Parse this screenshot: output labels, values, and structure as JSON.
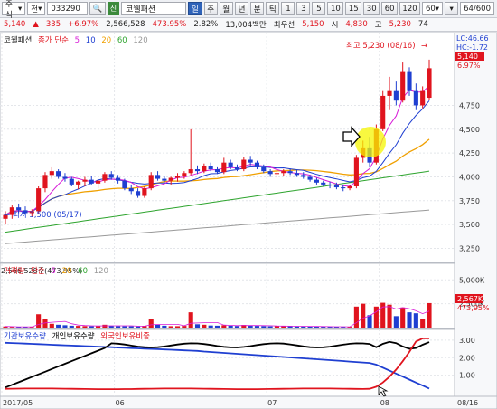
{
  "toolbar": {
    "market": "주식",
    "market_type": "전",
    "code": "033290",
    "tag": "신",
    "name": "코웰패션",
    "periods": [
      "일",
      "주",
      "월",
      "년",
      "분",
      "틱"
    ],
    "counts": [
      "1",
      "3",
      "5",
      "10",
      "15",
      "30",
      "60",
      "120"
    ],
    "extra": "60",
    "page": "64/600"
  },
  "quote": {
    "price": "5,140",
    "change": "335",
    "change_pct": "+6.97%",
    "volume": "2,566,528",
    "vol_ratio": "473.95%",
    "turnover": "2.82%",
    "amount": "13,004백만",
    "best": "최우선",
    "best_price": "5,150",
    "open_label": "시",
    "open": "4,830",
    "high_label": "고",
    "high": "5,230",
    "scroll": "74"
  },
  "price_panel": {
    "legend_title": "코웰패션",
    "legend_sub": "종가 단순",
    "ma": [
      "5",
      "10",
      "20",
      "60",
      "120"
    ],
    "max_label": "최고 5,230 (08/16)",
    "min_label": "최저 3,500 (05/17)",
    "lc": "LC:46.66",
    "hc": "HC:-1.72",
    "current": "5,140",
    "current_pct": "6.97%",
    "yticks": [
      "4,750",
      "4,500",
      "4,250",
      "4,000",
      "3,750",
      "3,500",
      "3,250"
    ]
  },
  "volume_panel": {
    "title": "거래량",
    "sub": "단순",
    "ma": [
      "5",
      "20",
      "60",
      "120"
    ],
    "value": "2,566,528주(473,95%)",
    "yticks": [
      "5,000K",
      "2,500K"
    ],
    "current": "2,567K",
    "current_pct": "473,95%"
  },
  "holding_panel": {
    "items": [
      "기관보유수량",
      "개인보유수량",
      "외국인보유비중"
    ],
    "yticks": [
      "3.00",
      "2.00",
      "1.00"
    ]
  },
  "dates": [
    "2017/05",
    "06",
    "07",
    "08",
    "08/16"
  ],
  "colors": {
    "up": "#e0141e",
    "down": "#1f3fd1",
    "ma5": "#d81bd8",
    "ma10": "#1f3fd1",
    "ma20": "#f0a000",
    "ma60": "#2ea42e",
    "ma120": "#999999"
  },
  "chart_data": {
    "type": "candlestick",
    "ohlc": [
      [
        3560,
        3640,
        3500,
        3600
      ],
      [
        3600,
        3700,
        3560,
        3680
      ],
      [
        3680,
        3720,
        3620,
        3650
      ],
      [
        3650,
        3690,
        3600,
        3620
      ],
      [
        3620,
        3660,
        3580,
        3640
      ],
      [
        3640,
        3900,
        3620,
        3880
      ],
      [
        3880,
        4050,
        3840,
        4020
      ],
      [
        4020,
        4100,
        3980,
        4060
      ],
      [
        4060,
        4080,
        3980,
        4000
      ],
      [
        4000,
        4040,
        3950,
        3980
      ],
      [
        3980,
        4000,
        3900,
        3920
      ],
      [
        3920,
        3960,
        3870,
        3950
      ],
      [
        3950,
        4000,
        3900,
        3970
      ],
      [
        3970,
        4010,
        3920,
        3930
      ],
      [
        3930,
        3970,
        3880,
        3960
      ],
      [
        3960,
        4050,
        3940,
        4030
      ],
      [
        4030,
        4060,
        3970,
        3990
      ],
      [
        3990,
        4020,
        3930,
        3960
      ],
      [
        3960,
        3980,
        3860,
        3880
      ],
      [
        3880,
        3920,
        3820,
        3850
      ],
      [
        3850,
        3880,
        3780,
        3800
      ],
      [
        3800,
        3900,
        3780,
        3880
      ],
      [
        3880,
        4050,
        3860,
        4020
      ],
      [
        4020,
        4060,
        3960,
        3980
      ],
      [
        3980,
        4010,
        3930,
        3960
      ],
      [
        3960,
        4000,
        3920,
        3990
      ],
      [
        3990,
        4040,
        3950,
        4010
      ],
      [
        4010,
        4060,
        3980,
        4040
      ],
      [
        4040,
        4500,
        4020,
        4080
      ],
      [
        4080,
        4120,
        4030,
        4060
      ],
      [
        4060,
        4140,
        4040,
        4110
      ],
      [
        4110,
        4150,
        4060,
        4080
      ],
      [
        4080,
        4100,
        4030,
        4050
      ],
      [
        4050,
        4200,
        4030,
        4150
      ],
      [
        4150,
        4180,
        4080,
        4100
      ],
      [
        4100,
        4130,
        4060,
        4080
      ],
      [
        4080,
        4210,
        4060,
        4180
      ],
      [
        4180,
        4220,
        4120,
        4150
      ],
      [
        4150,
        4170,
        4080,
        4100
      ],
      [
        4100,
        4130,
        4040,
        4060
      ],
      [
        4060,
        4080,
        4000,
        4030
      ],
      [
        4030,
        4060,
        3990,
        4040
      ],
      [
        4040,
        4080,
        4010,
        4060
      ],
      [
        4060,
        4090,
        4020,
        4040
      ],
      [
        4040,
        4070,
        4000,
        4020
      ],
      [
        4020,
        4050,
        3980,
        4000
      ],
      [
        4000,
        4020,
        3950,
        3970
      ],
      [
        3970,
        3990,
        3920,
        3940
      ],
      [
        3940,
        3960,
        3900,
        3920
      ],
      [
        3920,
        3950,
        3880,
        3910
      ],
      [
        3910,
        3940,
        3870,
        3890
      ],
      [
        3890,
        3920,
        3850,
        3880
      ],
      [
        3880,
        3910,
        3860,
        3900
      ],
      [
        3900,
        4230,
        3880,
        4200
      ],
      [
        4200,
        4380,
        4150,
        4300
      ],
      [
        4300,
        4420,
        4100,
        4150
      ],
      [
        4150,
        4550,
        4130,
        4500
      ],
      [
        4500,
        4900,
        4480,
        4850
      ],
      [
        4850,
        5050,
        4700,
        4900
      ],
      [
        4900,
        5000,
        4750,
        4800
      ],
      [
        4800,
        5200,
        4780,
        5100
      ],
      [
        5100,
        5150,
        4850,
        4900
      ],
      [
        4900,
        4980,
        4700,
        4750
      ],
      [
        4750,
        4950,
        4720,
        4900
      ],
      [
        4830,
        5230,
        4810,
        5140
      ]
    ],
    "volume": [
      120,
      80,
      60,
      70,
      50,
      1400,
      900,
      400,
      300,
      250,
      200,
      180,
      160,
      150,
      140,
      300,
      200,
      160,
      150,
      140,
      130,
      170,
      900,
      300,
      200,
      150,
      150,
      180,
      1600,
      350,
      300,
      220,
      200,
      250,
      200,
      170,
      280,
      240,
      180,
      160,
      140,
      150,
      160,
      140,
      130,
      120,
      110,
      100,
      100,
      90,
      90,
      80,
      80,
      2200,
      2500,
      1300,
      2200,
      2600,
      2400,
      1200,
      2100,
      1600,
      1500,
      900,
      2566
    ],
    "y_range": [
      3150,
      5400
    ],
    "volume_range": [
      0,
      5500
    ]
  }
}
